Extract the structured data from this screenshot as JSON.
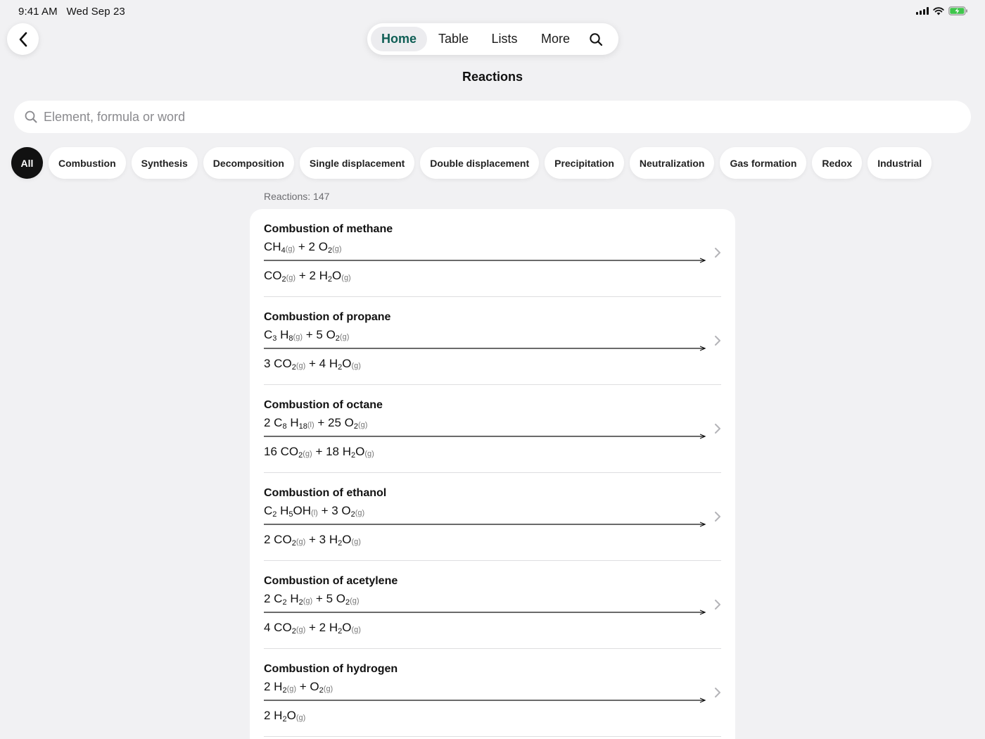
{
  "status_bar": {
    "time": "9:41 AM",
    "date": "Wed Sep 23"
  },
  "nav": {
    "tabs": [
      {
        "label": "Home",
        "active": true
      },
      {
        "label": "Table",
        "active": false
      },
      {
        "label": "Lists",
        "active": false
      },
      {
        "label": "More",
        "active": false
      }
    ]
  },
  "page_title": "Reactions",
  "search": {
    "placeholder": "Element, formula or word",
    "value": ""
  },
  "filters": [
    {
      "label": "All",
      "active": true
    },
    {
      "label": "Combustion",
      "active": false
    },
    {
      "label": "Synthesis",
      "active": false
    },
    {
      "label": "Decomposition",
      "active": false
    },
    {
      "label": "Single displacement",
      "active": false
    },
    {
      "label": "Double displacement",
      "active": false
    },
    {
      "label": "Precipitation",
      "active": false
    },
    {
      "label": "Neutralization",
      "active": false
    },
    {
      "label": "Gas formation",
      "active": false
    },
    {
      "label": "Redox",
      "active": false
    },
    {
      "label": "Industrial",
      "active": false
    }
  ],
  "count_label": "Reactions: 147",
  "reactions": [
    {
      "name": "Combustion of methane",
      "reactants": [
        [
          "CH",
          "4",
          "(g)"
        ],
        [
          "+ 2 O",
          "2",
          "(g)"
        ]
      ],
      "products": [
        [
          "CO",
          "2",
          "(g)"
        ],
        [
          "+ 2 H",
          "2",
          "O(g)"
        ]
      ]
    },
    {
      "name": "Combustion of propane",
      "reactants": [
        [
          "C",
          "3",
          ""
        ],
        [
          "H",
          "8",
          "(g)"
        ],
        [
          "+ 5 O",
          "2",
          "(g)"
        ]
      ],
      "products": [
        [
          "3 CO",
          "2",
          "(g)"
        ],
        [
          "+ 4 H",
          "2",
          "O(g)"
        ]
      ]
    },
    {
      "name": "Combustion of octane",
      "reactants": [
        [
          "2 C",
          "8",
          ""
        ],
        [
          "H",
          "18",
          "(l)"
        ],
        [
          "+ 25 O",
          "2",
          "(g)"
        ]
      ],
      "products": [
        [
          "16 CO",
          "2",
          "(g)"
        ],
        [
          "+ 18 H",
          "2",
          "O(g)"
        ]
      ]
    },
    {
      "name": "Combustion of ethanol",
      "reactants": [
        [
          "C",
          "2",
          ""
        ],
        [
          "H",
          "5",
          "OH(l)"
        ],
        [
          "+ 3 O",
          "2",
          "(g)"
        ]
      ],
      "products": [
        [
          "2 CO",
          "2",
          "(g)"
        ],
        [
          "+ 3 H",
          "2",
          "O(g)"
        ]
      ]
    },
    {
      "name": "Combustion of acetylene",
      "reactants": [
        [
          "2 C",
          "2",
          ""
        ],
        [
          "H",
          "2",
          "(g)"
        ],
        [
          "+ 5 O",
          "2",
          "(g)"
        ]
      ],
      "products": [
        [
          "4 CO",
          "2",
          "(g)"
        ],
        [
          "+ 2 H",
          "2",
          "O(g)"
        ]
      ]
    },
    {
      "name": "Combustion of hydrogen",
      "reactants": [
        [
          "2 H",
          "2",
          "(g)"
        ],
        [
          "+ O",
          "2",
          "(g)"
        ]
      ],
      "products": [
        [
          "2 H",
          "2",
          "O(g)"
        ]
      ]
    }
  ]
}
